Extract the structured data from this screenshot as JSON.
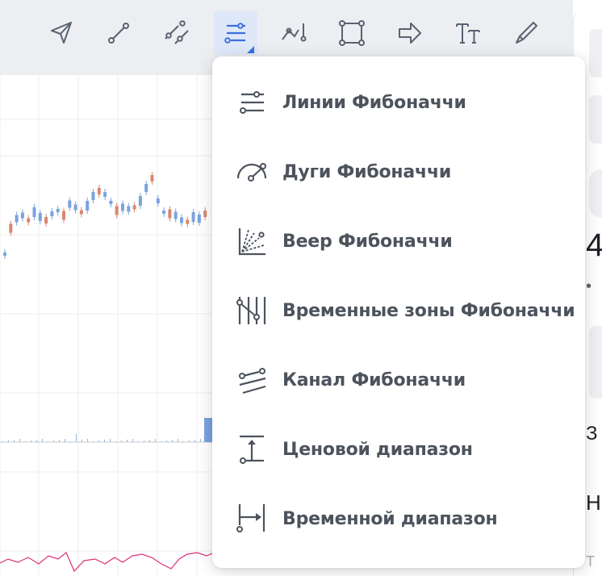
{
  "toolbar": {
    "tools": [
      {
        "icon": "cursor-arrow-icon"
      },
      {
        "icon": "trend-line-icon"
      },
      {
        "icon": "parallel-channel-icon"
      },
      {
        "icon": "fibonacci-tools-icon",
        "active": true
      },
      {
        "icon": "pattern-icon"
      },
      {
        "icon": "rectangle-icon"
      },
      {
        "icon": "arrow-icon"
      },
      {
        "icon": "text-tool-icon"
      },
      {
        "icon": "brush-icon"
      }
    ],
    "active_color": "#3a6fe0"
  },
  "menu": {
    "items": [
      {
        "label": "Линии Фибоначчи",
        "icon": "fibonacci-lines-icon"
      },
      {
        "label": "Дуги Фибоначчи",
        "icon": "fibonacci-arcs-icon"
      },
      {
        "label": "Веер Фибоначчи",
        "icon": "fibonacci-fan-icon"
      },
      {
        "label": "Временные зоны Фибоначчи",
        "icon": "fibonacci-time-zones-icon"
      },
      {
        "label": "Канал Фибоначчи",
        "icon": "fibonacci-channel-icon"
      },
      {
        "label": "Ценовой диапазон",
        "icon": "price-range-icon"
      },
      {
        "label": "Временной диапазон",
        "icon": "time-range-icon"
      }
    ]
  },
  "right_panel": {
    "texts": [
      "4",
      "•",
      "З",
      "Н",
      "Т"
    ]
  },
  "chart_colors": {
    "up": "#7aa3e0",
    "down": "#d9876f",
    "indicator": "#e0307a",
    "grid": "#eeeeee"
  }
}
